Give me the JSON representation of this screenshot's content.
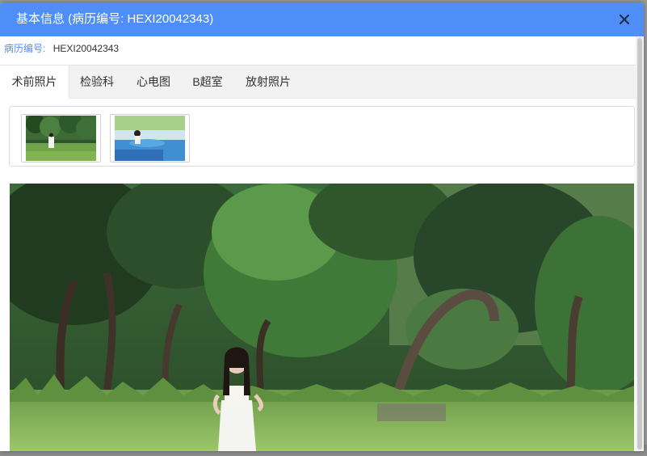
{
  "dialog": {
    "title": "基本信息 (病历编号: HEXI20042343)",
    "accent_color": "#4f8ef6"
  },
  "close_icon": "close-icon",
  "record": {
    "label": "病历编号:",
    "value": "HEXI20042343"
  },
  "tabs": [
    {
      "label": "术前照片",
      "active": true
    },
    {
      "label": "检验科",
      "active": false
    },
    {
      "label": "心电图",
      "active": false
    },
    {
      "label": "B超室",
      "active": false
    },
    {
      "label": "放射照片",
      "active": false
    }
  ],
  "thumbnails": [
    {
      "subject": "girl-in-forest-photo",
      "selected": true
    },
    {
      "subject": "girl-by-pool-photo",
      "selected": false
    }
  ],
  "main_photo": {
    "subject": "girl-in-forest-photo"
  }
}
